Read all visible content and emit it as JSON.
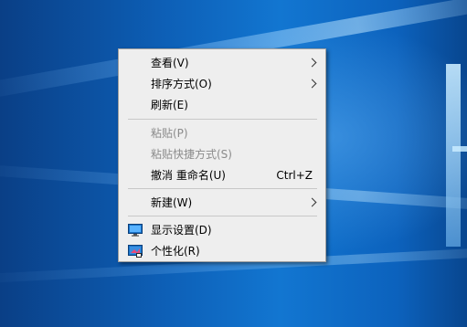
{
  "menu": {
    "view": "查看(V)",
    "sort_by": "排序方式(O)",
    "refresh": "刷新(E)",
    "paste": "粘贴(P)",
    "paste_shortcut": "粘贴快捷方式(S)",
    "undo_rename": "撤消 重命名(U)",
    "undo_shortcut": "Ctrl+Z",
    "new": "新建(W)",
    "display_settings": "显示设置(D)",
    "personalize": "个性化(R)"
  },
  "colors": {
    "menu_background": "#eeeeee",
    "disabled_text": "#8b8b8b",
    "desktop_blue": "#0d5fb6"
  },
  "icons": {
    "display_settings": "monitor-icon",
    "personalize": "personalize-icon",
    "submenu": "chevron-right-icon"
  }
}
